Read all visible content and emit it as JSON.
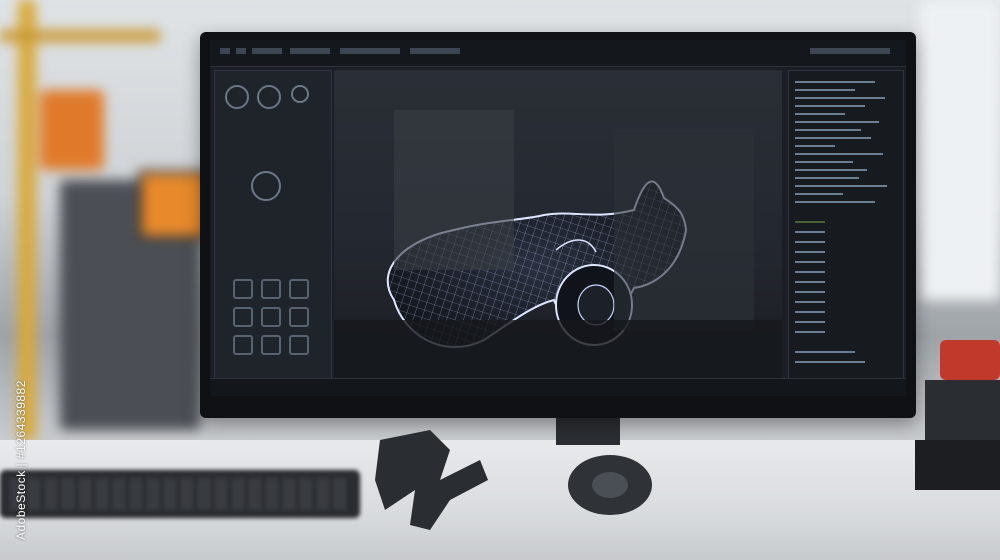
{
  "photo": {
    "subject": "CAD wireframe model",
    "watermark_text": "AdobeStock | #1264339882"
  },
  "colors": {
    "screen_bg": "#1b1e24",
    "wireframe": "#c9d6ff",
    "accent_orange": "#e07a2a",
    "shelf_yellow": "#d9a83a"
  }
}
